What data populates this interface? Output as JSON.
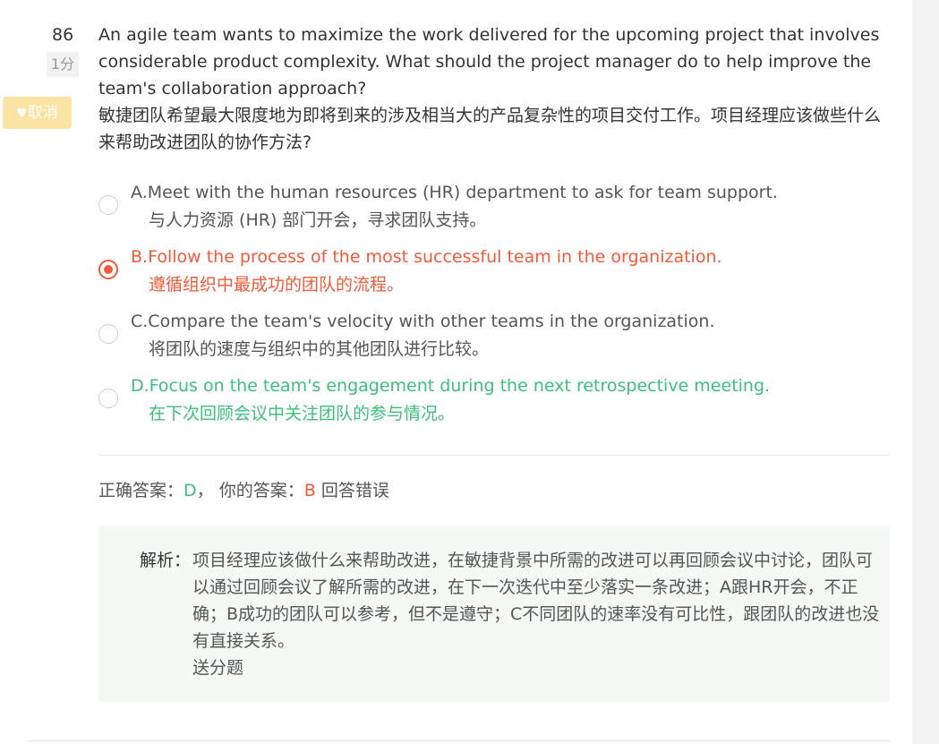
{
  "question": {
    "number": "86",
    "score": "1分",
    "favorite_label": "取消",
    "text_en": "An agile team wants to maximize the work delivered for the upcoming project that involves considerable product complexity. What should the project manager do to help improve the team's collaboration approach?",
    "text_zh": "敏捷团队希望最大限度地为即将到来的涉及相当大的产品复杂性的项目交付工作。项目经理应该做些什么来帮助改进团队的协作方法?"
  },
  "options": [
    {
      "en": "A.Meet with the human resources (HR) department to ask for team support.",
      "zh": "与人力资源 (HR) 部门开会，寻求团队支持。",
      "state": "normal",
      "selected": false
    },
    {
      "en": "B.Follow the process of the most successful team in the organization.",
      "zh": "遵循组织中最成功的团队的流程。",
      "state": "wrong",
      "selected": true
    },
    {
      "en": "C.Compare the team's velocity with other teams in the organization.",
      "zh": "将团队的速度与组织中的其他团队进行比较。",
      "state": "normal",
      "selected": false
    },
    {
      "en": "D.Focus on the team's engagement during the next retrospective meeting.",
      "zh": "在下次回顾会议中关注团队的参与情况。",
      "state": "right",
      "selected": false
    }
  ],
  "result": {
    "correct_label": "正确答案：",
    "correct_value": "D",
    "separator": "，",
    "your_label": "你的答案：",
    "your_value": "B",
    "verdict": "回答错误"
  },
  "analysis": {
    "label": "解析：",
    "text": "项目经理应该做什么来帮助改进，在敏捷背景中所需的改进可以再回顾会议中讨论，团队可以通过回顾会议了解所需的改进，在下一次迭代中至少落实一条改进；A跟HR开会，不正确；B成功的团队可以参考，但不是遵守；C不同团队的速率没有可比性，跟团队的改进也没有直接关系。",
    "note": "送分题"
  },
  "colors": {
    "wrong": "#f25a3a",
    "right": "#3cbf7a",
    "favorite_bg": "#fbe3a3"
  },
  "icons": {
    "favorite": "heart-icon",
    "radio": "radio-icon"
  }
}
